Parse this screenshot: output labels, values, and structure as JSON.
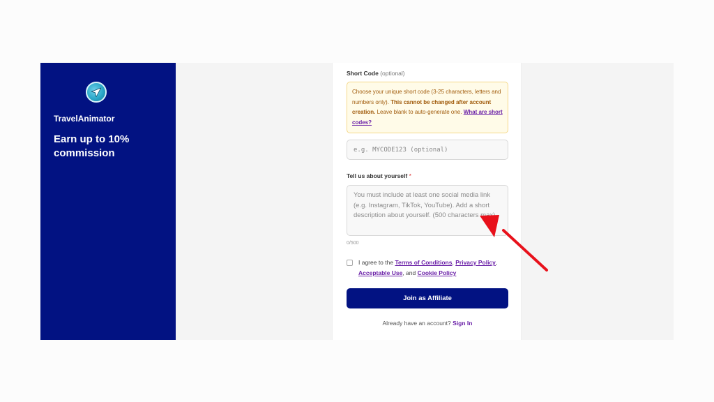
{
  "brand": {
    "name": "TravelAnimator",
    "tagline": "Earn up to 10% commission",
    "logo_icon": "airplane-globe-icon"
  },
  "form": {
    "short_code": {
      "label": "Short Code",
      "optional_tag": "(optional)",
      "notice_intro": "Choose your unique short code (3-25 characters, letters and numbers only).",
      "notice_warning": "This cannot be changed after account creation.",
      "notice_tail": "Leave blank to auto-generate one.",
      "notice_link": "What are short codes?",
      "placeholder": "e.g. MYCODE123 (optional)",
      "value": ""
    },
    "about": {
      "label": "Tell us about yourself",
      "required_mark": "*",
      "placeholder": "You must include at least one social media link (e.g. Instagram, TikTok, YouTube). Add a short description about yourself. (500 characters max)",
      "counter": "0/500"
    },
    "agreement": {
      "checked": false,
      "prefix": "I agree to the",
      "terms": "Terms of Conditions",
      "sep1": ",",
      "privacy": "Privacy Policy",
      "sep2": ",",
      "acceptable_use": "Acceptable Use",
      "sep3": ", and",
      "cookie": "Cookie Policy"
    },
    "submit_label": "Join as Affiliate",
    "signin_prompt": "Already have an account?",
    "signin_link": "Sign In"
  },
  "colors": {
    "brand_navy": "#021282",
    "link_purple": "#6b21a8",
    "notice_bg": "#fffbe8",
    "annotation_red": "#e8111b"
  }
}
